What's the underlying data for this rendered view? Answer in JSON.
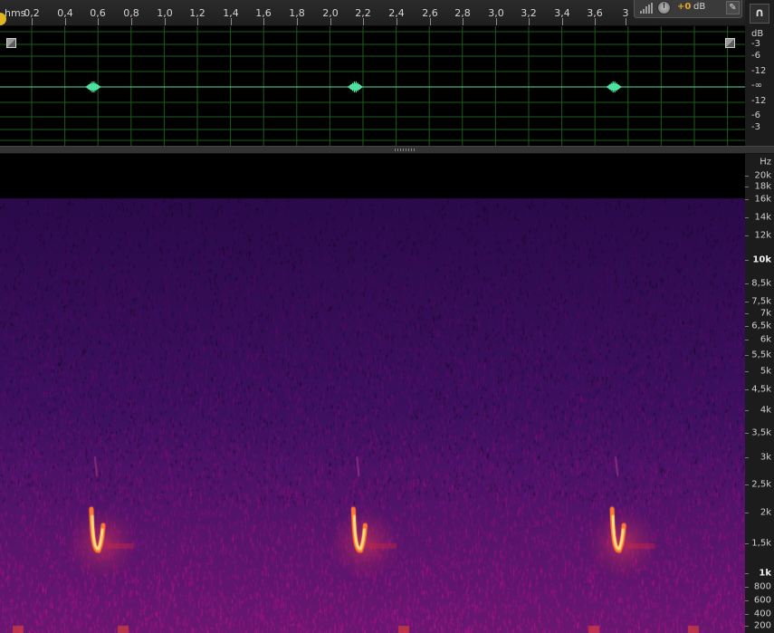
{
  "ruler": {
    "units_label": "hms",
    "ticks": [
      "0,2",
      "0,4",
      "0,6",
      "0,8",
      "1,0",
      "1,2",
      "1,4",
      "1,6",
      "1,8",
      "2,0",
      "2,2",
      "2,4",
      "2,6",
      "2,8",
      "3,0",
      "3,2",
      "3,4",
      "3,6",
      "3"
    ]
  },
  "volume_hud": {
    "value": "+0",
    "unit": "dB",
    "pin_icon": "pin-icon",
    "level_icon": "volume-level-icon",
    "knob_icon": "volume-knob-icon"
  },
  "snap_button": {
    "icon": "magnet-snap-icon",
    "glyph": "∩"
  },
  "amplitude_scale": [
    "dB",
    "-3",
    "-6",
    "-12",
    "-∞",
    "-12",
    "-6",
    "-3"
  ],
  "frequency_scale": {
    "unit": "Hz",
    "labels": [
      {
        "text": "20k"
      },
      {
        "text": "18k"
      },
      {
        "text": "16k"
      },
      {
        "text": "14k"
      },
      {
        "text": "12k"
      },
      {
        "text": "10k",
        "major": true
      },
      {
        "text": "8,5k"
      },
      {
        "text": "7,5k"
      },
      {
        "text": "7k"
      },
      {
        "text": "6,5k"
      },
      {
        "text": "6k"
      },
      {
        "text": "5,5k"
      },
      {
        "text": "5k"
      },
      {
        "text": "4,5k"
      },
      {
        "text": "4k"
      },
      {
        "text": "3,5k"
      },
      {
        "text": "3k"
      },
      {
        "text": "2,5k"
      },
      {
        "text": "2k"
      },
      {
        "text": "1,5k"
      },
      {
        "text": "1k",
        "major": true
      },
      {
        "text": "800"
      },
      {
        "text": "600"
      },
      {
        "text": "400"
      },
      {
        "text": "200"
      }
    ]
  },
  "waveform": {
    "color": "#4fe0a0",
    "grid_color": "#1e5a1e",
    "events_seconds": [
      0.57,
      2.15,
      3.71
    ]
  },
  "spectrogram": {
    "background_color": "#3a0f5a",
    "cutoff_hz": "16k",
    "hot_color": "#ffe080"
  }
}
